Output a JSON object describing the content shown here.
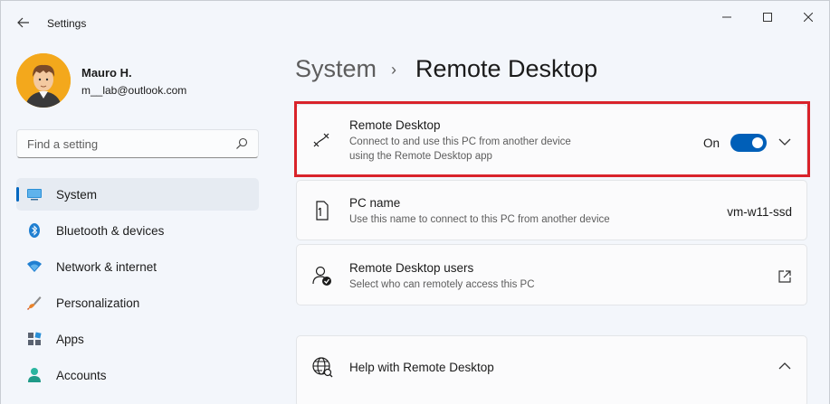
{
  "window": {
    "app_title": "Settings",
    "controls": [
      "minimize",
      "maximize",
      "close"
    ]
  },
  "profile": {
    "name": "Mauro H.",
    "email": "m__lab@outlook.com"
  },
  "search": {
    "placeholder": "Find a setting"
  },
  "nav": {
    "items": [
      {
        "label": "System",
        "icon": "monitor-icon",
        "selected": true
      },
      {
        "label": "Bluetooth & devices",
        "icon": "bluetooth-icon",
        "selected": false
      },
      {
        "label": "Network & internet",
        "icon": "wifi-icon",
        "selected": false
      },
      {
        "label": "Personalization",
        "icon": "brush-icon",
        "selected": false
      },
      {
        "label": "Apps",
        "icon": "apps-icon",
        "selected": false
      },
      {
        "label": "Accounts",
        "icon": "person-icon",
        "selected": false
      }
    ]
  },
  "breadcrumb": {
    "parent": "System",
    "separator": "›",
    "current": "Remote Desktop"
  },
  "cards": {
    "remote_desktop": {
      "title": "Remote Desktop",
      "desc_line1": "Connect to and use this PC from another device",
      "desc_line2": "using the Remote Desktop app",
      "toggle_state_label": "On",
      "toggle_on": true,
      "icon": "remote-desktop-icon"
    },
    "pc_name": {
      "title": "PC name",
      "desc": "Use this name to connect to this PC from another device",
      "value": "vm-w11-ssd",
      "icon": "pc-name-icon"
    },
    "rd_users": {
      "title": "Remote Desktop users",
      "desc": "Select who can remotely access this PC",
      "icon": "users-icon"
    },
    "help": {
      "title": "Help with Remote Desktop",
      "icon": "globe-icon"
    }
  },
  "colors": {
    "accent": "#005fb8",
    "highlight_border": "#d9232a",
    "background": "#f3f6fb"
  }
}
